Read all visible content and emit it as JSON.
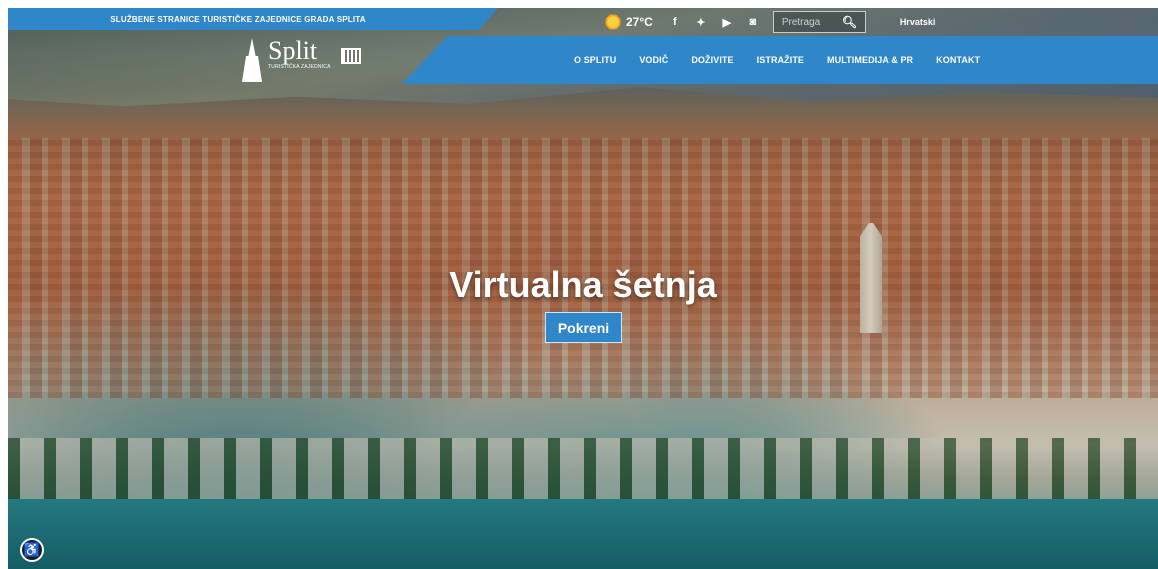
{
  "header": {
    "official_banner": "SLUŽBENE STRANICE TURISTIČKE ZAJEDNICE GRADA SPLITA",
    "weather": {
      "icon": "sun-icon",
      "temperature": "27°C"
    },
    "social": [
      {
        "name": "facebook-icon",
        "glyph": "f"
      },
      {
        "name": "twitter-icon",
        "glyph": "🐦"
      },
      {
        "name": "youtube-icon",
        "glyph": "▶"
      },
      {
        "name": "instagram-icon",
        "glyph": "◙"
      }
    ],
    "search": {
      "placeholder": "Pretraga",
      "value": ""
    },
    "language": "Hrvatski"
  },
  "logo": {
    "word": "Split",
    "subtitle": "TURISTIČKA ZAJEDNICA"
  },
  "nav": {
    "items": [
      {
        "label": "O SPLITU"
      },
      {
        "label": "VODIČ"
      },
      {
        "label": "DOŽIVITE"
      },
      {
        "label": "ISTRAŽITE"
      },
      {
        "label": "MULTIMEDIJA & PR"
      },
      {
        "label": "KONTAKT"
      }
    ]
  },
  "hero": {
    "title": "Virtualna šetnja",
    "button": "Pokreni"
  },
  "colors": {
    "brand_blue": "#2f86c9"
  }
}
